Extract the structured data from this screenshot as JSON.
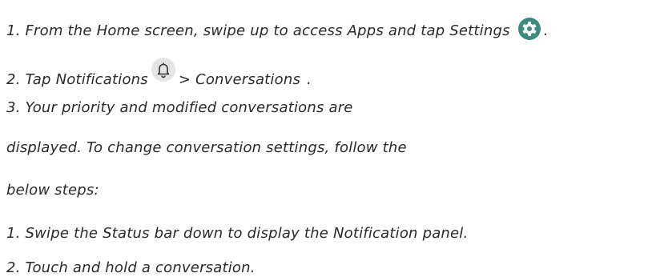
{
  "colors": {
    "text": "#2a2a2a",
    "settings_icon_bg": "#3d8a80",
    "bell_icon_bg": "#e5e5e5",
    "bell_icon_fg": "#333333"
  },
  "steps": {
    "step1": {
      "text": "1. From the Home screen, swipe up to access Apps and tap Settings",
      "icon": "settings-gear-icon",
      "trail": "."
    },
    "step2": {
      "prefix": "2. Tap Notifications",
      "icon": "bell-icon",
      "suffix": "> Conversations",
      "trail": "."
    },
    "step3_line1": "3. Your priority and modified conversations are",
    "step3_line2": "displayed. To change conversation settings, follow the",
    "step3_line3": "below steps:",
    "sub1": "1. Swipe the Status bar down to display the Notification panel.",
    "sub2": "2. Touch and hold a conversation."
  }
}
